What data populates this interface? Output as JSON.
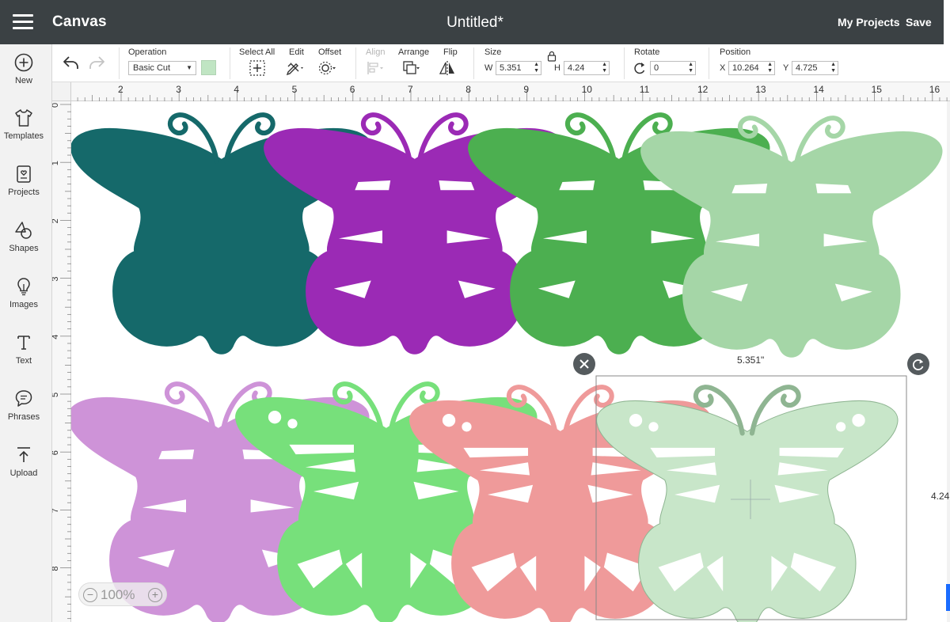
{
  "header": {
    "app_title": "Canvas",
    "doc_title": "Untitled*",
    "my_projects": "My Projects",
    "save": "Save"
  },
  "sidebar": {
    "items": [
      {
        "label": "New",
        "icon": "plus-circle-icon"
      },
      {
        "label": "Templates",
        "icon": "tshirt-icon"
      },
      {
        "label": "Projects",
        "icon": "projects-icon"
      },
      {
        "label": "Shapes",
        "icon": "shapes-icon"
      },
      {
        "label": "Images",
        "icon": "lightbulb-icon"
      },
      {
        "label": "Text",
        "icon": "text-icon"
      },
      {
        "label": "Phrases",
        "icon": "speech-bubble-icon"
      },
      {
        "label": "Upload",
        "icon": "upload-icon"
      }
    ]
  },
  "toolbar": {
    "operation_label": "Operation",
    "operation_value": "Basic Cut",
    "select_all": "Select All",
    "edit": "Edit",
    "offset": "Offset",
    "align": "Align",
    "arrange": "Arrange",
    "flip": "Flip",
    "size": "Size",
    "w_label": "W",
    "w_value": "5.351",
    "h_label": "H",
    "h_value": "4.24",
    "rotate": "Rotate",
    "rotate_value": "0",
    "position": "Position",
    "x_label": "X",
    "x_value": "10.264",
    "y_label": "Y",
    "y_value": "4.725",
    "swatch_color": "#c0e5c3"
  },
  "ruler": {
    "horizontal": [
      "2",
      "3",
      "4",
      "5",
      "6",
      "7",
      "8",
      "9",
      "10",
      "11",
      "12",
      "13",
      "14",
      "15",
      "16"
    ],
    "vertical": [
      "0",
      "1",
      "2",
      "3",
      "4",
      "5",
      "6",
      "7",
      "8"
    ]
  },
  "canvas": {
    "width_dimension": "5.351\"",
    "height_dimension": "4.24"
  },
  "zoom": {
    "level": "100%"
  },
  "colors": {
    "teal": "#15696a",
    "purple": "#9b2ab5",
    "green": "#4caf50",
    "pale_green": "#a5d6a7",
    "lavender": "#ce93d8",
    "light_green": "#77e07b",
    "salmon": "#ef9a9a",
    "mint": "#c8e6c9"
  }
}
